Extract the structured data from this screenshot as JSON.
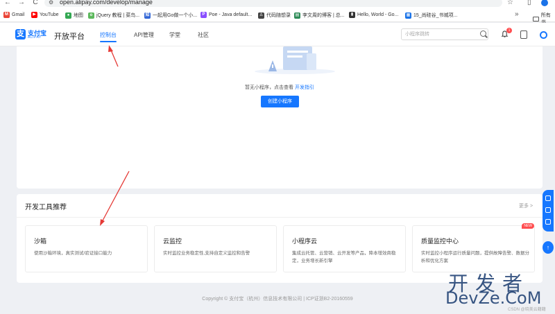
{
  "browser": {
    "back": "←",
    "forward": "→",
    "reload": "C",
    "url": "open.alipay.com/develop/manage",
    "bookmarks": [
      {
        "label": "Gmail",
        "icon": "gmail-icon",
        "color": "#ea4335"
      },
      {
        "label": "YouTube",
        "icon": "youtube-icon",
        "color": "#ff0000"
      },
      {
        "label": "地图",
        "icon": "maps-icon",
        "color": "#34a853"
      },
      {
        "label": "jQuery 教程 | 菜鸟...",
        "icon": "runoob-icon",
        "color": "#5cb85c"
      },
      {
        "label": "一起用Go做一个小...",
        "icon": "go-icon",
        "color": "#3367d6"
      },
      {
        "label": "Poe - Java default...",
        "icon": "poe-icon",
        "color": "#8a4fff"
      },
      {
        "label": "代码随想录",
        "icon": "person-icon",
        "color": "#444444"
      },
      {
        "label": "李文周的博客 | 总...",
        "icon": "blog-icon",
        "color": "#2e8b57"
      },
      {
        "label": "Hello, World - Go...",
        "icon": "book-icon",
        "color": "#333333"
      },
      {
        "label": "15_尚硅谷_书城项...",
        "icon": "calendar-icon",
        "color": "#1a73e8"
      }
    ],
    "more": "»",
    "all_bookmarks": "所有书"
  },
  "header": {
    "logo_cn": "支付宝",
    "logo_en": "ALIPAY",
    "platform": "开放平台",
    "nav": [
      "控制台",
      "API管理",
      "学堂",
      "社区"
    ],
    "search_placeholder": "小程序跳转",
    "badge": "1"
  },
  "empty": {
    "text": "暂无小程序，点击查看",
    "link": "开发指引",
    "button": "创建小程序"
  },
  "tools": {
    "title": "开发工具推荐",
    "more": "更多 >",
    "items": [
      {
        "name": "沙箱",
        "desc": "使用沙箱环境，真实测试/验证接口能力"
      },
      {
        "name": "云监控",
        "desc": "实时监控业务稳定性,支持自定义监控和告警"
      },
      {
        "name": "小程序云",
        "desc": "集成云托管、云营销、云开发等产品，降本增效商稳定，业务增长新引擎"
      },
      {
        "name": "质量监控中心",
        "desc": "实时监控小程序运行质量问题，提供故障告警、数据分析和优化方案",
        "badge": "NEW"
      }
    ]
  },
  "footer": "Copyright © 支付宝（杭州）信息技术有限公司 | ICP证浙B2-20160559",
  "watermark": {
    "big": "开发者",
    "en": "DevZe.CoM",
    "small": "CSDN @晓美云籍籍"
  }
}
